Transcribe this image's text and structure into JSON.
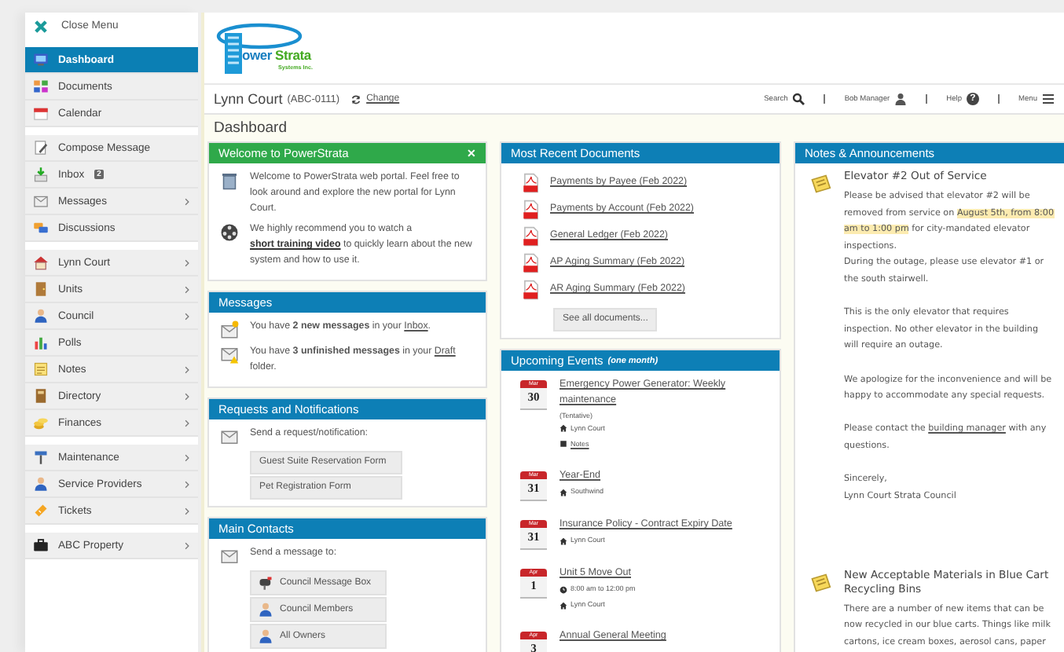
{
  "sidebar": {
    "close_label": "Close Menu",
    "groups": [
      [
        {
          "label": "Dashboard",
          "selected": true,
          "submenu": false
        },
        {
          "label": "Documents",
          "selected": false,
          "submenu": false
        },
        {
          "label": "Calendar",
          "selected": false,
          "submenu": false
        }
      ],
      [
        {
          "label": "Compose Message",
          "selected": false,
          "submenu": false
        },
        {
          "label": "Inbox",
          "selected": false,
          "submenu": false,
          "badge": "2"
        },
        {
          "label": "Messages",
          "selected": false,
          "submenu": true
        },
        {
          "label": "Discussions",
          "selected": false,
          "submenu": false
        }
      ],
      [
        {
          "label": "Lynn Court",
          "selected": false,
          "submenu": true
        },
        {
          "label": "Units",
          "selected": false,
          "submenu": true
        },
        {
          "label": "Council",
          "selected": false,
          "submenu": true
        },
        {
          "label": "Polls",
          "selected": false,
          "submenu": false
        },
        {
          "label": "Notes",
          "selected": false,
          "submenu": true
        },
        {
          "label": "Directory",
          "selected": false,
          "submenu": true
        },
        {
          "label": "Finances",
          "selected": false,
          "submenu": true
        }
      ],
      [
        {
          "label": "Maintenance",
          "selected": false,
          "submenu": true
        },
        {
          "label": "Service Providers",
          "selected": false,
          "submenu": true
        },
        {
          "label": "Tickets",
          "selected": false,
          "submenu": true
        }
      ],
      [
        {
          "label": "ABC Property",
          "selected": false,
          "submenu": true
        }
      ]
    ]
  },
  "logo": {
    "word1": "ower",
    "word2": "Strata",
    "tagline": "Systems Inc."
  },
  "title_bar": {
    "property": "Lynn Court",
    "code": "(ABC-0111)",
    "change_link": "Change",
    "search": "Search",
    "user": "Bob Manager",
    "help": "Help",
    "help_glyph": "?",
    "menu": "Menu"
  },
  "heading": "Dashboard",
  "welcome": {
    "title": "Welcome to PowerStrata",
    "close": "✕",
    "intro": "Welcome to PowerStrata web portal. Feel free to look around and explore the new portal for Lynn Court.",
    "recommend": {
      "before": "We highly recommend you to watch a ",
      "link": "short training video",
      "after": " to quickly learn about the new system and how to use it."
    }
  },
  "messages": {
    "title": "Messages",
    "items": [
      {
        "before": "You have **2 new messages** in your ",
        "link": "Inbox",
        "after": "."
      },
      {
        "before": "You have **3 unfinished messages** in your ",
        "link": "Draft",
        "after": " folder."
      }
    ]
  },
  "requests": {
    "title": "Requests and Notifications",
    "prompt": "Send a request/notification:",
    "forms": [
      "Guest Suite Reservation Form",
      "Pet Registration Form"
    ]
  },
  "contacts": {
    "title": "Main Contacts",
    "prompt": "Send a message to:",
    "buttons": [
      "Council Message Box",
      "Council Members",
      "All Owners"
    ]
  },
  "documents": {
    "title": "Most Recent Documents",
    "items": [
      "Payments by Payee (Feb 2022)",
      "Payments by Account (Feb 2022)",
      "General Ledger (Feb 2022)",
      "AP Aging Summary (Feb 2022)",
      "AR Aging Summary (Feb 2022)"
    ],
    "see_all": "See all documents..."
  },
  "events": {
    "title": "Upcoming Events",
    "scope": "(one month)",
    "items": [
      {
        "month": "Mar",
        "day": "30",
        "title": "Emergency Power Generator: Weekly maintenance",
        "status": "(Tentative)",
        "details": [
          {
            "kind": "location",
            "text": "Lynn Court"
          },
          {
            "kind": "notes",
            "text": "Notes"
          }
        ]
      },
      {
        "month": "Mar",
        "day": "31",
        "title": "Year-End",
        "details": [
          {
            "kind": "location",
            "text": "Southwind"
          }
        ]
      },
      {
        "month": "Mar",
        "day": "31",
        "title": "Insurance Policy - Contract Expiry Date",
        "details": [
          {
            "kind": "location",
            "text": "Lynn Court"
          }
        ]
      },
      {
        "month": "Apr",
        "day": "1",
        "title": "Unit 5 Move Out",
        "details": [
          {
            "kind": "time",
            "text": "8:00 am to 12:00 pm"
          },
          {
            "kind": "location",
            "text": "Lynn Court"
          }
        ]
      },
      {
        "month": "Apr",
        "day": "3",
        "title": "Annual General Meeting"
      }
    ]
  },
  "notes": {
    "title": "Notes & Announcements",
    "items": [
      {
        "title": "Elevator #2 Out of Service",
        "blocks": [
          [
            [
              {
                "kind": "text",
                "text": "Please be advised that elevator #2 will be removed from service on "
              },
              {
                "kind": "highlight",
                "text": "August 5th, from 8:00 am to 1:00 pm"
              },
              {
                "kind": "text",
                "text": " for city-mandated elevator inspections."
              }
            ],
            [
              {
                "kind": "text",
                "text": "During the outage, please use elevator #1 or the south stairwell."
              }
            ]
          ],
          [
            [
              {
                "kind": "text",
                "text": "This is the only elevator that requires inspection. No other elevator in the building will require an outage."
              }
            ]
          ],
          [
            [
              {
                "kind": "text",
                "text": "We apologize for the inconvenience and will be happy to accommodate any special requests."
              }
            ]
          ],
          [
            [
              {
                "kind": "text",
                "text": "Please contact the "
              },
              {
                "kind": "link",
                "text": "building manager"
              },
              {
                "kind": "text",
                "text": " with any questions."
              }
            ]
          ],
          [
            [
              {
                "kind": "text",
                "text": "Sincerely,"
              }
            ],
            [
              {
                "kind": "text",
                "text": "Lynn Court Strata Council"
              }
            ]
          ]
        ]
      },
      {
        "title": "New Acceptable Materials in Blue Cart Recycling Bins",
        "blocks": [
          [
            [
              {
                "kind": "text",
                "text": "There are a number of new items that can be now recycled in our blue carts. Things like milk cartons, ice cream boxes, aerosol cans, paper"
              }
            ]
          ]
        ]
      }
    ]
  }
}
